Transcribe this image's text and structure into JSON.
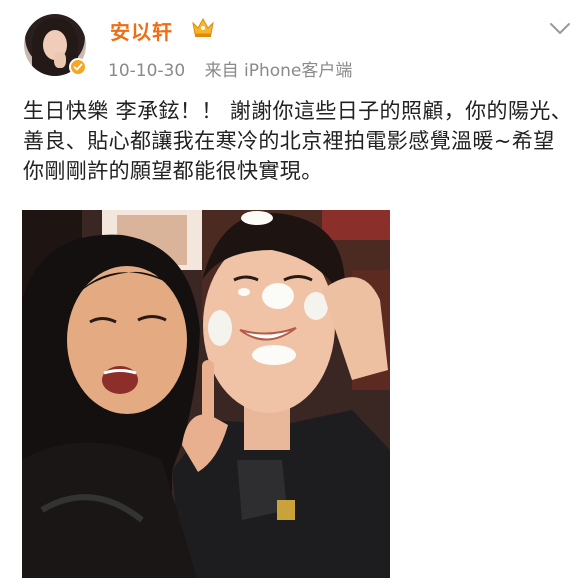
{
  "post": {
    "username": "安以轩",
    "timestamp": "10-10-30",
    "source": "来自 iPhone客户端",
    "content": "生日快樂 李承鉉！！ 謝謝你這些日子的照顧，你的陽光、善良、貼心都讓我在寒冷的北京裡拍電影感覺溫暖~希望你剛剛許的願望都能很快實現。"
  },
  "icons": {
    "avatar": "avatar-photo",
    "badge": "verified-badge",
    "crown": "crown-icon",
    "menu": "chevron-down-icon"
  },
  "colors": {
    "username": "#f06d12",
    "meta": "#8a8a8a",
    "text": "#222222",
    "badge": "#f5a623"
  }
}
